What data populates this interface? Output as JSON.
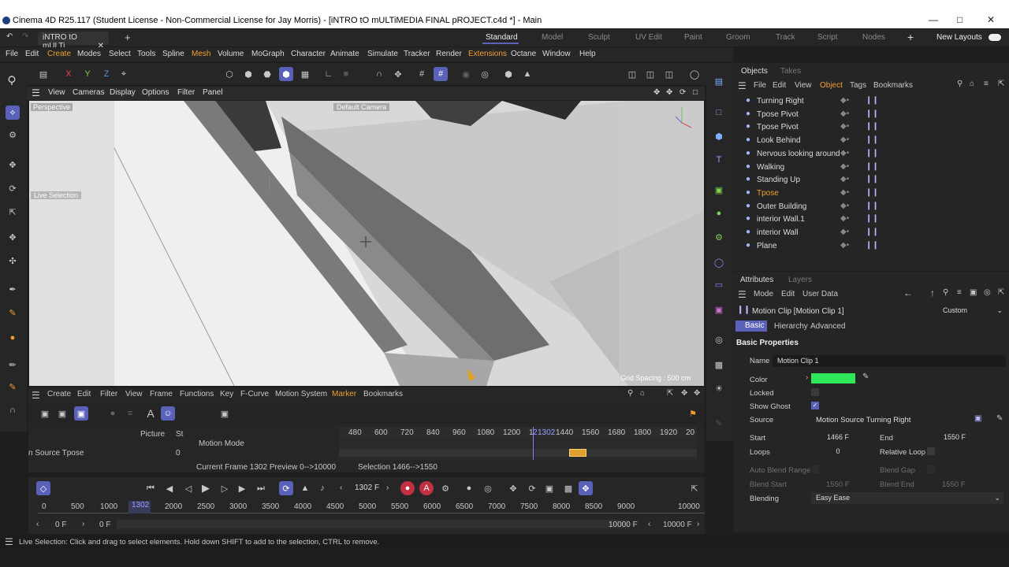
{
  "window": {
    "title": "Cinema 4D R25.117 (Student License - Non-Commercial License for Jay Morris) - [iNTRO tO mULTiMEDIA FINAL pROJECT.c4d *] - Main"
  },
  "doc_tab": "iNTRO tO mULTi...",
  "layouts": [
    "Standard",
    "Model",
    "Sculpt",
    "UV Edit",
    "Paint",
    "Groom",
    "Track",
    "Script",
    "Nodes"
  ],
  "new_layouts": "New Layouts",
  "menu": [
    "File",
    "Edit",
    "Create",
    "Modes",
    "Select",
    "Tools",
    "Spline",
    "Mesh",
    "Volume",
    "MoGraph",
    "Character",
    "Animate",
    "Simulate",
    "Tracker",
    "Render",
    "Extensions",
    "Octane",
    "Window",
    "Help"
  ],
  "axis": {
    "x": "X",
    "y": "Y",
    "z": "Z"
  },
  "viewport": {
    "menu": [
      "View",
      "Cameras",
      "Display",
      "Options",
      "Filter",
      "Panel"
    ],
    "label": "Perspective",
    "camera": "Default Camera",
    "selection_hud": "Live Selection",
    "grid": "Grid Spacing : 500 cm"
  },
  "objects": {
    "tabs": [
      "Objects",
      "Takes"
    ],
    "menu": [
      "File",
      "Edit",
      "View",
      "Object",
      "Tags",
      "Bookmarks"
    ],
    "items": [
      {
        "name": "Turning Right",
        "color": "#dcdcdc"
      },
      {
        "name": "Tpose Pivot",
        "color": "#dcdcdc"
      },
      {
        "name": "Tpose Pivot",
        "color": "#dcdcdc"
      },
      {
        "name": "Look Behind",
        "color": "#dcdcdc"
      },
      {
        "name": "Nervous looking around",
        "color": "#dcdcdc"
      },
      {
        "name": "Walking",
        "color": "#dcdcdc"
      },
      {
        "name": "Standing Up",
        "color": "#dcdcdc"
      },
      {
        "name": "Tpose",
        "color": "#f0a030"
      },
      {
        "name": "Outer Building",
        "color": "#dcdcdc"
      },
      {
        "name": "interior Wall.1",
        "color": "#dcdcdc"
      },
      {
        "name": "interior Wall",
        "color": "#dcdcdc"
      },
      {
        "name": "Plane",
        "color": "#dcdcdc"
      }
    ]
  },
  "attributes": {
    "tabs": [
      "Attributes",
      "Layers"
    ],
    "menu": [
      "Mode",
      "Edit",
      "User Data"
    ],
    "title": "Motion Clip [Motion Clip 1]",
    "preset": "Custom",
    "subtabs": [
      "Basic",
      "Hierarchy",
      "Advanced"
    ],
    "section": "Basic Properties",
    "name_label": "Name",
    "name_value": "Motion Clip 1",
    "color_label": "Color",
    "color_value": "#2ee85a",
    "locked_label": "Locked",
    "ghost_label": "Show Ghost",
    "source_label": "Source",
    "source_value": "Motion Source Turning Right",
    "start_label": "Start",
    "start_value": "1466 F",
    "end_label": "End",
    "end_value": "1550 F",
    "loops_label": "Loops",
    "loops_value": "0",
    "relative_label": "Relative Loop",
    "auto_blend_label": "Auto Blend Range",
    "blend_gap_label": "Blend Gap",
    "blend_start_label": "Blend Start",
    "blend_start_value": "1550 F",
    "blend_end_label": "Blend End",
    "blend_end_value": "1550 F",
    "blending_label": "Blending",
    "blending_value": "Easy Ease"
  },
  "timeline": {
    "menu": [
      "Create",
      "Edit",
      "Filter",
      "View",
      "Frame",
      "Functions",
      "Key",
      "F-Curve",
      "Motion System",
      "Marker",
      "Bookmarks"
    ],
    "col_picture": "Picture",
    "col_st": "St",
    "mode": "Motion Mode",
    "track": "n Source Tpose",
    "track_val": "0",
    "ruler": [
      "480",
      "600",
      "720",
      "840",
      "960",
      "1080",
      "1200",
      "1",
      "2",
      "1302",
      "1440",
      "1560",
      "1680",
      "1800",
      "1920",
      "20"
    ],
    "info": "Current Frame  1302  Preview  0-->10000",
    "selection": "Selection 1466-->1550"
  },
  "transport": {
    "frame": "1302 F",
    "ruler": [
      "0",
      "500",
      "1000",
      "1302",
      "2000",
      "2500",
      "3000",
      "3500",
      "4000",
      "4500",
      "5000",
      "5500",
      "6000",
      "6500",
      "7000",
      "7500",
      "8000",
      "8500",
      "9000",
      "10000"
    ],
    "start": "0 F",
    "start2": "0 F",
    "end": "10000 F",
    "end2": "10000 F"
  },
  "status": "Live Selection: Click and drag to select elements. Hold down SHIFT to add to the selection, CTRL to remove."
}
